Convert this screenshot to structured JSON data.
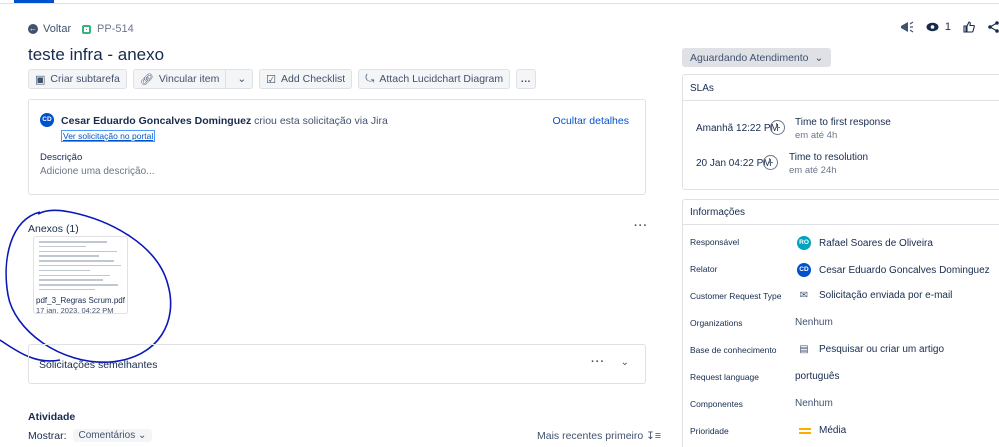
{
  "header": {
    "back_label": "Voltar",
    "issue_key": "PP-514",
    "watchers_count": "1",
    "title": "teste infra - anexo"
  },
  "toolbar": {
    "create_subtask": "Criar subtarefa",
    "link_issue": "Vincular item",
    "add_checklist": "Add Checklist",
    "attach_lucidchart": "Attach Lucidchart Diagram"
  },
  "request": {
    "avatar_initials": "CD",
    "author": "Cesar Eduardo Goncalves Dominguez",
    "created_text": "criou esta solicitação via",
    "channel": "Jira",
    "portal_link": "Ver solicitação no portal",
    "hide_details": "Ocultar detalhes",
    "description_label": "Descrição",
    "description_placeholder": "Adicione uma descrição..."
  },
  "attachments": {
    "title": "Anexos (1)",
    "items": [
      {
        "file_name": "pdf_3_Regras Scrum.pdf",
        "date": "17 jan. 2023, 04:22 PM"
      }
    ]
  },
  "similar": {
    "label": "Solicitações semelhantes"
  },
  "activity": {
    "title": "Atividade",
    "show_label": "Mostrar:",
    "show_value": "Comentários",
    "sort_label": "Mais recentes primeiro"
  },
  "status": {
    "label": "Aguardando Atendimento"
  },
  "slas": {
    "title": "SLAs",
    "rows": [
      {
        "when": "Amanhã 12:22 PM",
        "goal": "Time to first response",
        "sub": "em até 4h"
      },
      {
        "when": "20 Jan 04:22 PM",
        "goal": "Time to resolution",
        "sub": "em até 24h"
      }
    ]
  },
  "info": {
    "title": "Informações",
    "rows": [
      {
        "key": "Responsável",
        "value": "Rafael Soares de Oliveira",
        "avatar": "RO"
      },
      {
        "key": "Relator",
        "value": "Cesar Eduardo Goncalves Dominguez",
        "avatar": "CD"
      },
      {
        "key": "Customer Request Type",
        "value": "Solicitação enviada por e-mail"
      },
      {
        "key": "Organizations",
        "value": "Nenhum"
      },
      {
        "key": "Base de conhecimento",
        "value": "Pesquisar ou criar um artigo"
      },
      {
        "key": "Request language",
        "value": "português"
      },
      {
        "key": "Componentes",
        "value": "Nenhum"
      },
      {
        "key": "Prioridade",
        "value": "Média"
      }
    ]
  },
  "colors": {
    "accent": "#0052cc",
    "issue_type": "#36b37e",
    "priority_medium": "#ffab00",
    "scribble": "#0a18b8"
  },
  "icons": [
    "arrow-left-icon",
    "issue-type-icon",
    "megaphone-icon",
    "eye-icon",
    "like-icon",
    "share-icon",
    "subtask-icon",
    "link-icon",
    "chevron-down-icon",
    "checklist-icon",
    "lucidchart-icon",
    "more-icon",
    "clock-icon",
    "email-icon",
    "knowledge-base-icon",
    "priority-medium-icon",
    "sort-icon"
  ]
}
